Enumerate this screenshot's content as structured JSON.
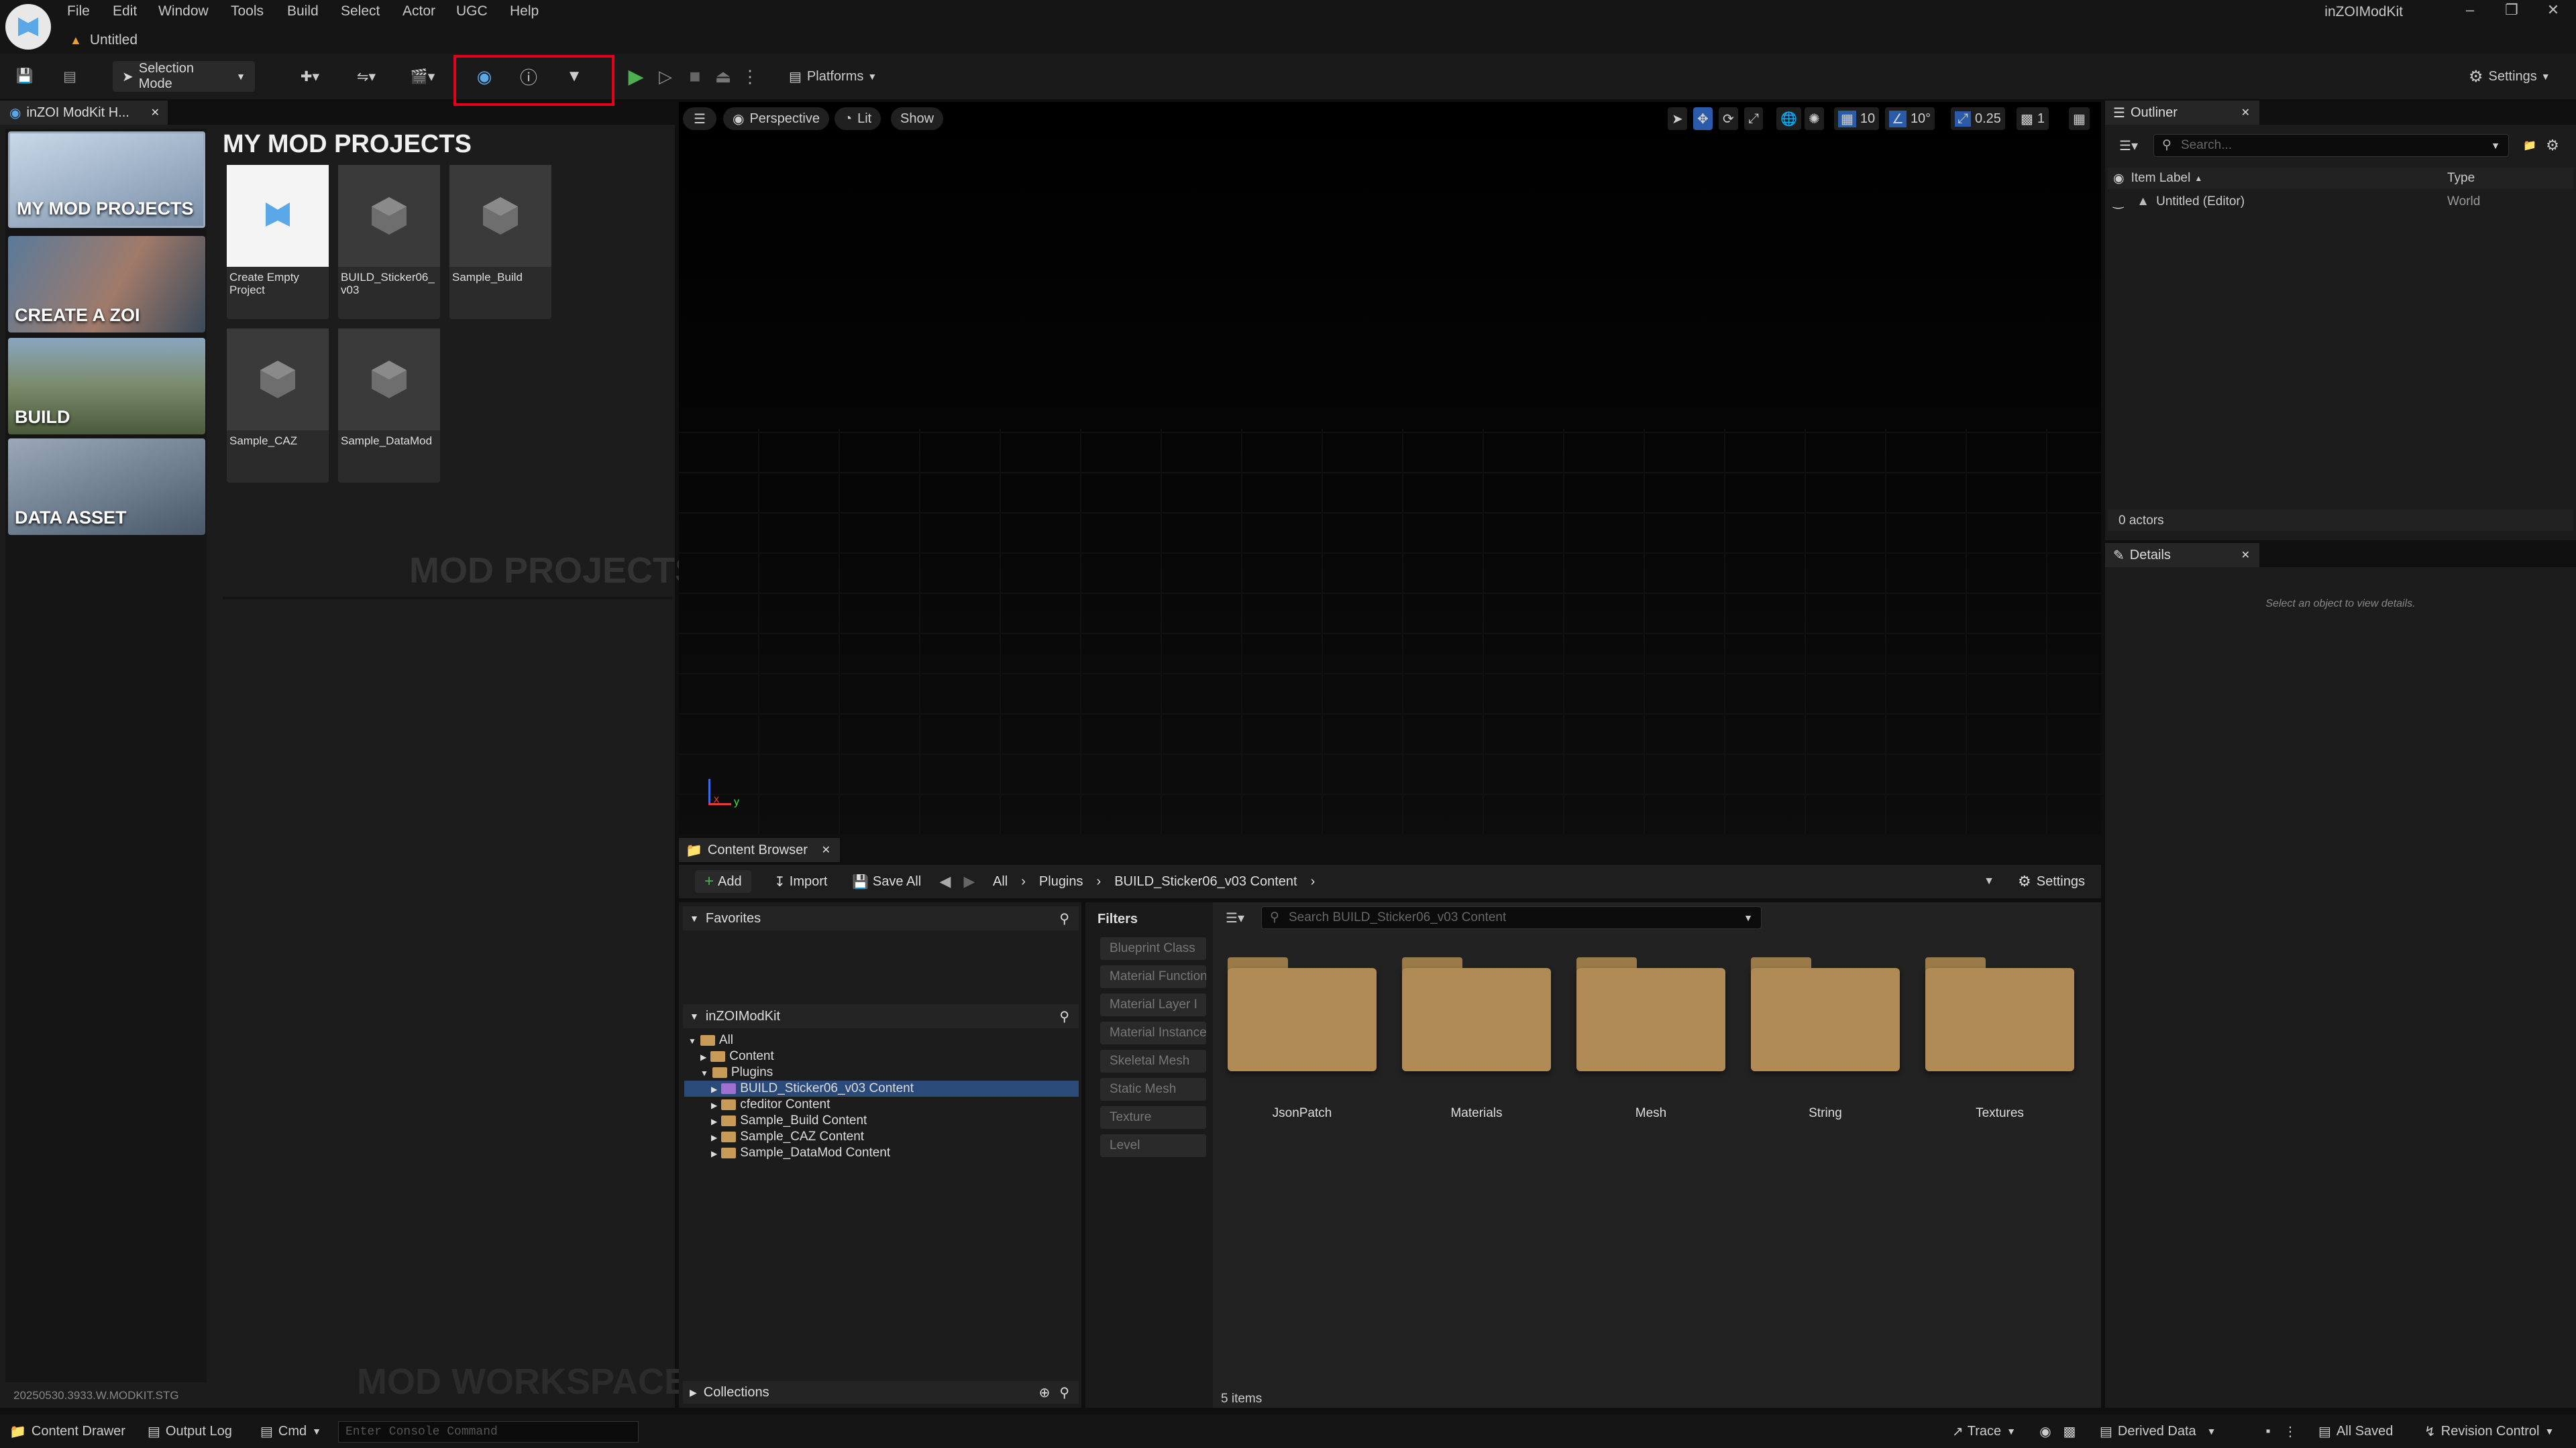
{
  "menu": [
    "File",
    "Edit",
    "Window",
    "Tools",
    "Build",
    "Select",
    "Actor",
    "UGC",
    "Help"
  ],
  "app_name": "inZOIModKit",
  "doc_tab": "Untitled",
  "toolbar": {
    "selection_mode": "Selection Mode",
    "platforms": "Platforms",
    "settings": "Settings"
  },
  "left_tab": "inZOI ModKit H...",
  "categories": [
    "MY MOD PROJECTS",
    "CREATE A ZOI",
    "BUILD",
    "DATA ASSET"
  ],
  "projects_title": "MY MOD PROJECTS",
  "projects": [
    "Create Empty Project",
    "BUILD_Sticker06_v03",
    "Sample_Build",
    "Sample_CAZ",
    "Sample_DataMod"
  ],
  "mod_projects_watermark": "MOD PROJECTS",
  "mod_workspaces_watermark": "MOD WORKSPACES",
  "version": "20250530.3933.W.MODKIT.STG",
  "viewport": {
    "perspective": "Perspective",
    "lit": "Lit",
    "show": "Show",
    "grid": "10",
    "angle": "10°",
    "scale": "0.25",
    "cam": "1"
  },
  "content_browser": {
    "tab": "Content Browser",
    "add": "Add",
    "import": "Import",
    "save_all": "Save All",
    "path": [
      "All",
      "Plugins",
      "BUILD_Sticker06_v03 Content"
    ],
    "settings": "Settings",
    "favorites": "Favorites",
    "root": "inZOIModKit",
    "tree": [
      "All",
      "Content",
      "Plugins",
      "BUILD_Sticker06_v03 Content",
      "cfeditor Content",
      "Sample_Build Content",
      "Sample_CAZ Content",
      "Sample_DataMod Content"
    ],
    "collections": "Collections",
    "filters_title": "Filters",
    "filters": [
      "Blueprint Class",
      "Material Function",
      "Material Layer I",
      "Material Instance",
      "Skeletal Mesh",
      "Static Mesh",
      "Texture",
      "Level"
    ],
    "search_placeholder": "Search BUILD_Sticker06_v03 Content",
    "folders": [
      "JsonPatch",
      "Materials",
      "Mesh",
      "String",
      "Textures"
    ],
    "item_count": "5 items"
  },
  "outliner": {
    "tab": "Outliner",
    "search_placeholder": "Search...",
    "col_label": "Item Label",
    "col_type": "Type",
    "row_label": "Untitled (Editor)",
    "row_type": "World",
    "actors": "0 actors"
  },
  "details": {
    "tab": "Details",
    "empty": "Select an object to view details."
  },
  "statusbar": {
    "content_drawer": "Content Drawer",
    "output_log": "Output Log",
    "cmd": "Cmd",
    "console_placeholder": "Enter Console Command",
    "trace": "Trace",
    "derived_data": "Derived Data",
    "all_saved": "All Saved",
    "revision_control": "Revision Control"
  },
  "colors": {
    "accent": "#e3001b",
    "folder": "#b08b55",
    "selected": "#2a4a7a",
    "play": "#4caf50"
  }
}
